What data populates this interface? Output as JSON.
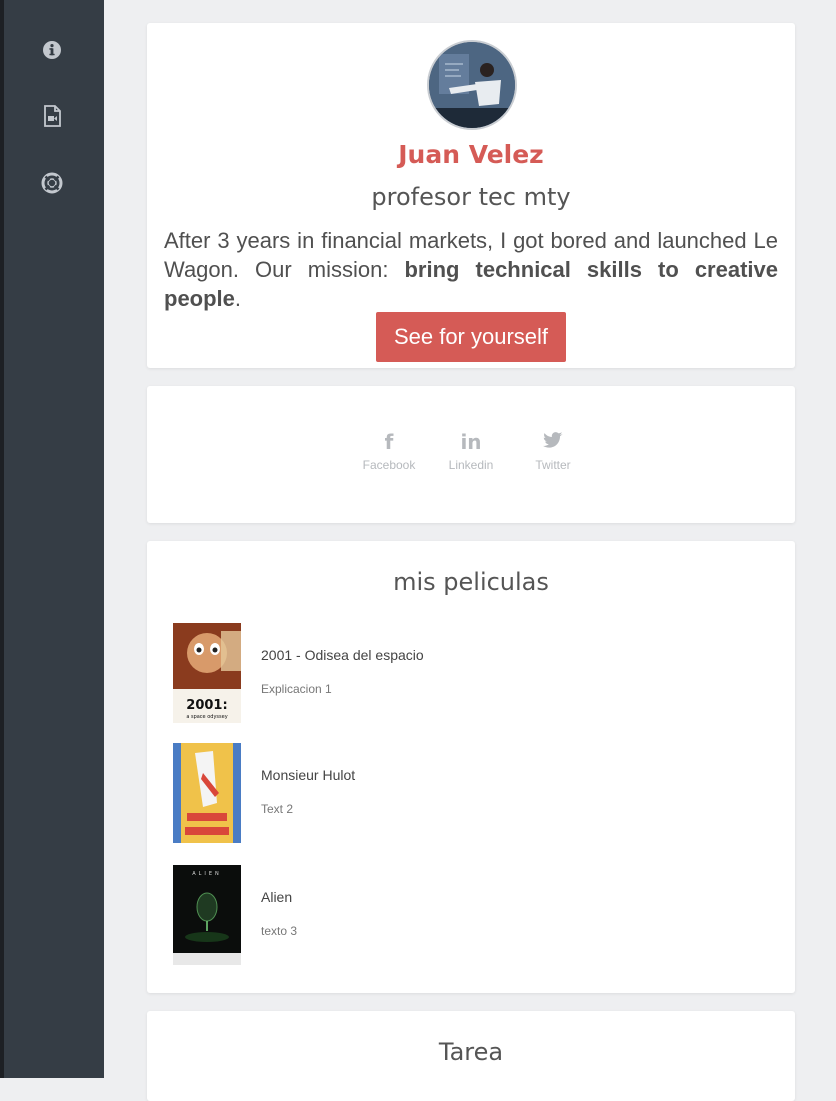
{
  "sidebar": {
    "items": [
      {
        "icon": "info-icon"
      },
      {
        "icon": "video-file-icon"
      },
      {
        "icon": "lifebuoy-icon"
      }
    ]
  },
  "profile": {
    "name": "Juan Velez",
    "role": "profesor tec mty",
    "bio_plain_1": "After 3 years in financial markets, I got bored and launched Le Wagon. Our mission: ",
    "bio_bold": "bring technical skills to creative people",
    "bio_plain_2": ".",
    "cta_label": "See for yourself"
  },
  "social": [
    {
      "icon": "facebook-icon",
      "glyph": "f",
      "label": "Facebook"
    },
    {
      "icon": "linkedin-icon",
      "glyph": "in",
      "label": "Linkedin"
    },
    {
      "icon": "twitter-icon",
      "glyph": "🐦",
      "label": "Twitter"
    }
  ],
  "movies": {
    "title": "mis peliculas",
    "items": [
      {
        "title": "2001 - Odisea del espacio",
        "description": "Explicacion 1",
        "poster_text": "2001:",
        "poster_subtext": "a space odyssey"
      },
      {
        "title": "Monsieur Hulot",
        "description": "Text 2"
      },
      {
        "title": "Alien",
        "description": "texto 3",
        "poster_text": "ALIEN"
      }
    ]
  },
  "tarea": {
    "title": "Tarea"
  },
  "colors": {
    "accent": "#d55b56",
    "sidebar": "#353d45",
    "background": "#eeeff1"
  }
}
